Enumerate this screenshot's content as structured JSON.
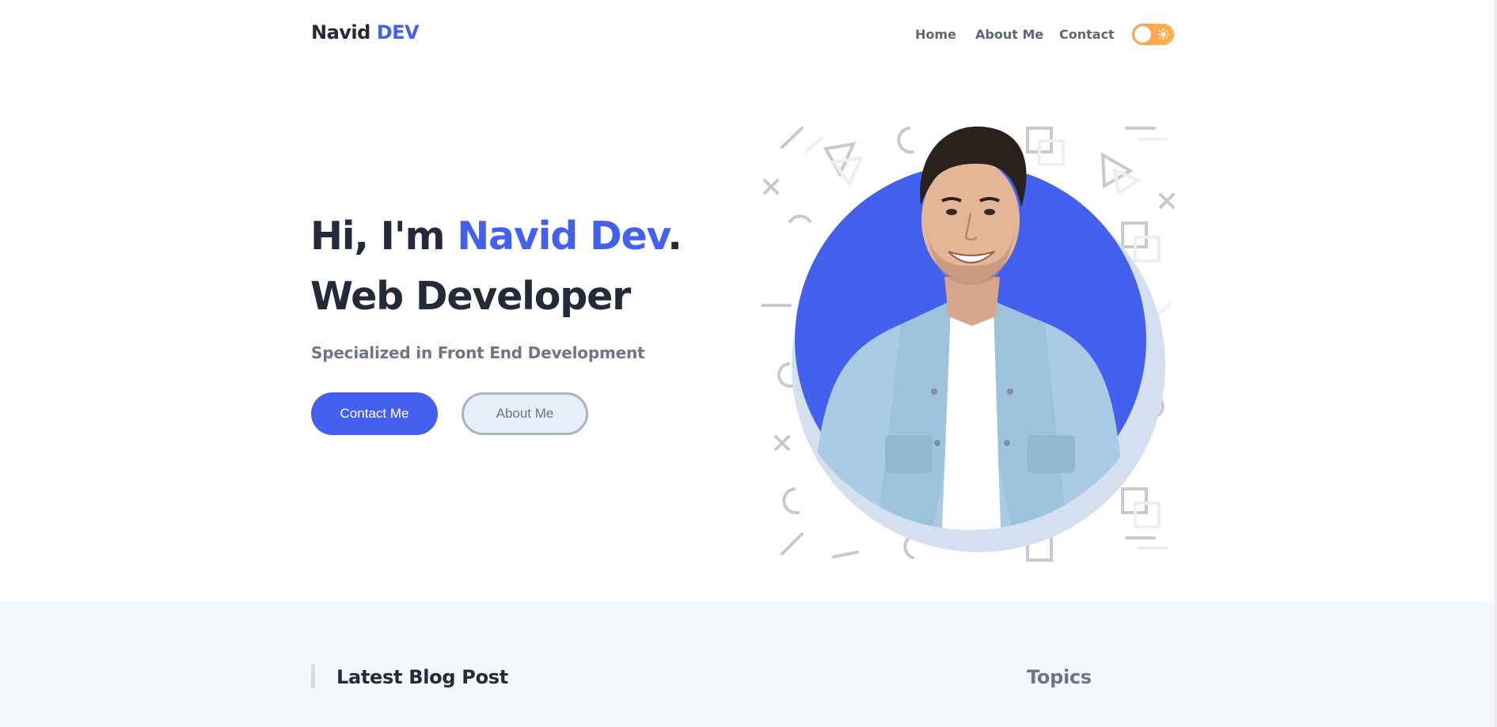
{
  "header": {
    "logo_first": "Navid",
    "logo_accent": "DEV",
    "nav": [
      "Home",
      "About Me",
      "Contact"
    ],
    "theme_toggle_icon": "sun-icon"
  },
  "hero": {
    "greeting_prefix": "Hi, I'm ",
    "name": "Navid Dev",
    "greeting_suffix": ".",
    "role": "Web Developer",
    "subtitle": "Specialized in Front End Development",
    "primary_button": "Contact Me",
    "secondary_button": "About Me"
  },
  "blog": {
    "latest_title": "Latest Blog Post",
    "topics_title": "Topics"
  },
  "colors": {
    "accent": "#4361ee",
    "dark_text": "#232a3a",
    "muted_text": "#6d7587",
    "toggle": "#ffa24f",
    "section_bg": "#f3f8fc"
  }
}
